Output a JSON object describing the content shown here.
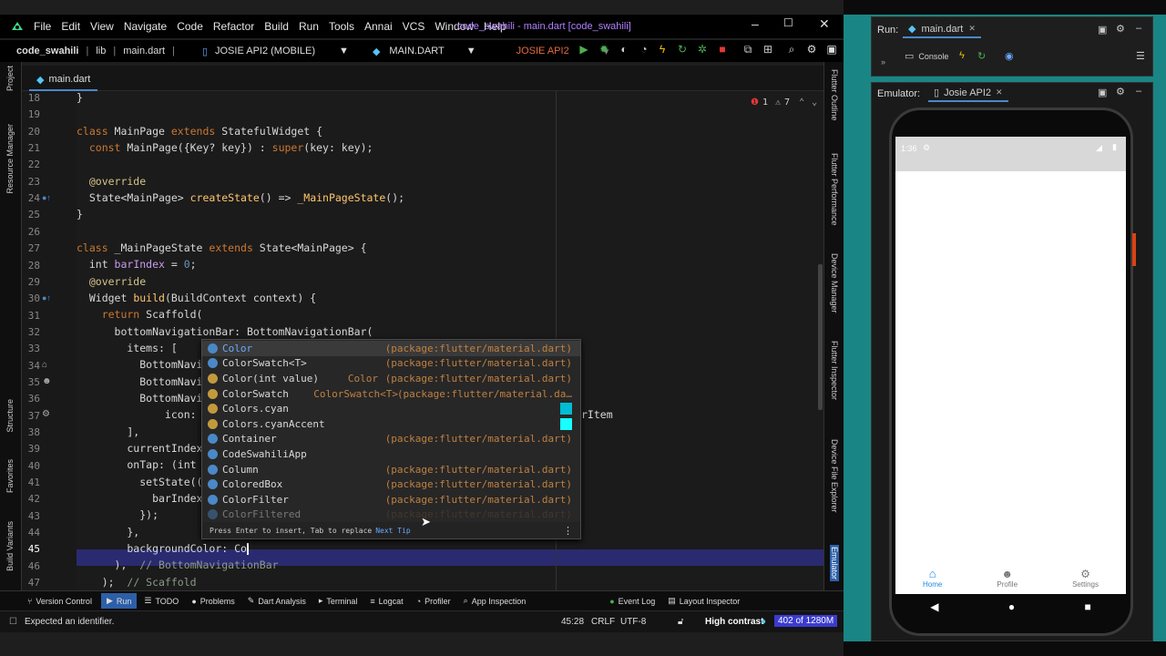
{
  "menu": {
    "items": [
      "File",
      "Edit",
      "View",
      "Navigate",
      "Code",
      "Refactor",
      "Build",
      "Run",
      "Tools",
      "Annai",
      "VCS",
      "Window",
      "Help"
    ],
    "window_title": "code_swahili - main.dart [code_swahili]"
  },
  "nav": {
    "project": "code_swahili",
    "lib": "lib",
    "file": "main.dart",
    "device": "JOSIE API2 (MOBILE)",
    "run_config": "MAIN.DART",
    "device2": "JOSIE API2"
  },
  "file_tab": "main.dart",
  "inspections": {
    "errors": "1",
    "warnings": "7"
  },
  "line_numbers": [
    "18",
    "19",
    "20",
    "21",
    "22",
    "23",
    "24",
    "25",
    "26",
    "27",
    "28",
    "29",
    "30",
    "31",
    "32",
    "33",
    "34",
    "35",
    "36",
    "37",
    "38",
    "39",
    "40",
    "41",
    "42",
    "43",
    "44",
    "45",
    "46",
    "47"
  ],
  "code": {
    "l20a": "class ",
    "l20b": "MainPage ",
    "l20c": "extends ",
    "l20d": "StatefulWidget {",
    "l21a": "  const ",
    "l21b": "MainPage({Key? key}) : ",
    "l21c": "super",
    "l21d": "(key: key);",
    "l23": "  @override",
    "l24a": "  State<MainPage> ",
    "l24b": "createState",
    "l24c": "() => ",
    "l24d": "_MainPageState",
    "l24e": "();",
    "l25": "}",
    "l27a": "class ",
    "l27b": "_MainPageState ",
    "l27c": "extends ",
    "l27d": "State<MainPage> {",
    "l28a": "  int ",
    "l28b": "barIndex",
    "l28c": " = ",
    "l28d": "0",
    ";": ";",
    "l29": "  @override",
    "l30a": "  Widget ",
    "l30b": "build",
    "l30c": "(BuildContext context) {",
    "l31a": "    return ",
    "l31b": "Scaffold(",
    "l32a": "      bottomNavigationBar: ",
    "l32b": "BottomNavigationBar(",
    "l33": "        items: [",
    "l34": "          BottomNaviga",
    "l35": "          BottomNaviga",
    "l36": "          BottomNaviga",
    "l37a": "              icon: Ic",
    "l37b": "rItem",
    "l38": "        ],",
    "l39": "        currentIndex:",
    "l40": "        onTap: (int in",
    "l41": "          setState(()",
    "l42": "            barIndex =",
    "l43": "          });",
    "l44": "        },",
    "l45": "        backgroundColor: Co",
    "l46a": "      ),  ",
    "l46b": "// BottomNavigationBar",
    "l47a": "    );  ",
    "l47b": "// Scaffold"
  },
  "completion": {
    "items": [
      {
        "name": "Color",
        "pkg": "(package:flutter/material.dart)",
        "icon": "class-icon"
      },
      {
        "name": "ColorSwatch<T>",
        "pkg": "(package:flutter/material.dart)",
        "icon": "class-icon"
      },
      {
        "name": "Color(int value)",
        "mid": "Color",
        "pkg": "(package:flutter/material.dart)",
        "icon": "constructor-icon"
      },
      {
        "name": "ColorSwatch",
        "mid": "ColorSwatch<T>",
        "pkg": "(package:flutter/material.da…",
        "icon": "constructor-icon"
      },
      {
        "name": "Colors.cyan",
        "pkg": "",
        "icon": "field-icon"
      },
      {
        "name": "Colors.cyanAccent",
        "pkg": "",
        "icon": "field-icon"
      },
      {
        "name": "Container",
        "pkg": "(package:flutter/material.dart)",
        "icon": "class-icon"
      },
      {
        "name": "CodeSwahiliApp",
        "pkg": "",
        "icon": "class-icon"
      },
      {
        "name": "Column",
        "pkg": "(package:flutter/material.dart)",
        "icon": "class-icon"
      },
      {
        "name": "ColoredBox",
        "pkg": "(package:flutter/material.dart)",
        "icon": "class-icon"
      },
      {
        "name": "ColorFilter",
        "pkg": "(package:flutter/material.dart)",
        "icon": "class-icon"
      },
      {
        "name": "ColorFiltered",
        "pkg": "(package:flutter/material.dart)",
        "icon": "class-icon"
      }
    ],
    "footer": "Press Enter to insert, Tab to replace",
    "next_tip": "Next Tip"
  },
  "left_tools": [
    "Project",
    "Resource Manager",
    "Structure",
    "Favorites",
    "Build Variants"
  ],
  "right_tools": [
    "Flutter Outline",
    "Flutter Performance",
    "Device Manager",
    "Flutter Inspector",
    "Device File Explorer",
    "Emulator"
  ],
  "bottom_tabs": [
    "Version Control",
    "Run",
    "TODO",
    "Problems",
    "Dart Analysis",
    "Terminal",
    "Logcat",
    "Profiler",
    "App Inspection",
    "Event Log",
    "Layout Inspector"
  ],
  "status": {
    "message": "Expected an identifier.",
    "position": "45:28",
    "line_sep": "CRLF",
    "encoding": "UTF-8",
    "contrast": "High contrast",
    "memory": "402 of 1280M"
  },
  "run_panel": {
    "label": "Run:",
    "tab": "main.dart",
    "console": "Console"
  },
  "emulator": {
    "label": "Emulator:",
    "device": "Josie API2",
    "time": "1:36"
  },
  "app_nav": [
    {
      "label": "Home",
      "icon": "home-icon"
    },
    {
      "label": "Profile",
      "icon": "person-icon"
    },
    {
      "label": "Settings",
      "icon": "gear-icon"
    }
  ],
  "colors": {
    "accent": "#1e88e5",
    "teal": "#1a8585",
    "purple": "#b080ff"
  }
}
